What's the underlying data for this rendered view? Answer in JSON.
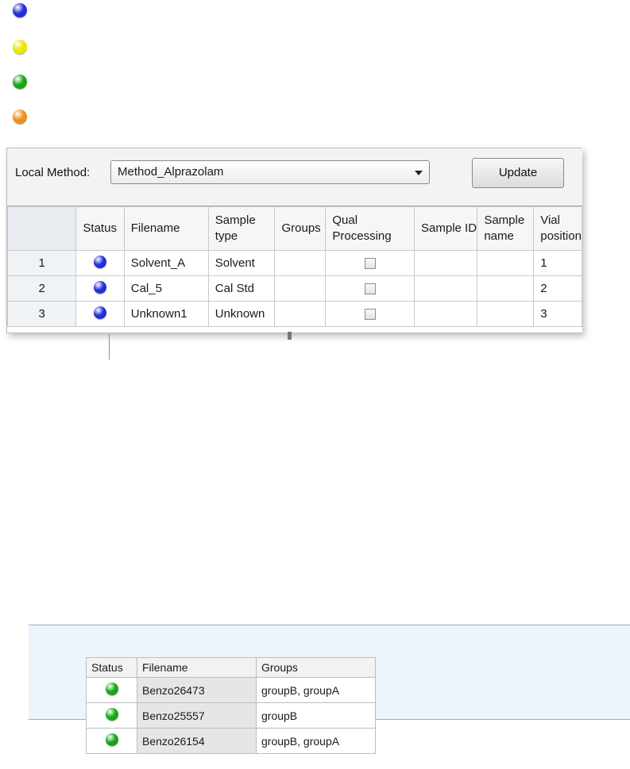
{
  "colors": {
    "blue": "#1f2fd6",
    "yellow": "#efe600",
    "green": "#14a814",
    "orange": "#f0901e"
  },
  "legend": [
    {
      "icon": "blue-status-orb-icon",
      "color": "blue"
    },
    {
      "icon": "yellow-status-orb-icon",
      "color": "yellow"
    },
    {
      "icon": "green-status-orb-icon",
      "color": "green"
    },
    {
      "icon": "orange-status-orb-icon",
      "color": "orange"
    }
  ],
  "sample_list": {
    "method_label": "Local Method:",
    "method_value": "Method_Alprazolam",
    "update_label": "Update",
    "columns": [
      "",
      "Status",
      "Filename",
      "Sample type",
      "Groups",
      "Qual Processing",
      "Sample ID",
      "Sample name",
      "Vial position"
    ],
    "rows": [
      {
        "num": "1",
        "status": "blue",
        "filename": "Solvent_A",
        "sample_type": "Solvent",
        "groups": "",
        "qual_processing": false,
        "sample_id": "",
        "sample_name": "",
        "vial": "1"
      },
      {
        "num": "2",
        "status": "blue",
        "filename": "Cal_5",
        "sample_type": "Cal Std",
        "groups": "",
        "qual_processing": false,
        "sample_id": "",
        "sample_name": "",
        "vial": "2"
      },
      {
        "num": "3",
        "status": "blue",
        "filename": "Unknown1",
        "sample_type": "Unknown",
        "groups": "",
        "qual_processing": false,
        "sample_id": "",
        "sample_name": "",
        "vial": "3"
      }
    ]
  },
  "groups_example": {
    "columns": [
      "Status",
      "Filename",
      "Groups"
    ],
    "rows": [
      {
        "status": "green",
        "filename": "Benzo26473",
        "groups": "groupB, groupA"
      },
      {
        "status": "green",
        "filename": "Benzo25557",
        "groups": "groupB"
      },
      {
        "status": "green",
        "filename": "Benzo26154",
        "groups": "groupB, groupA"
      }
    ]
  }
}
